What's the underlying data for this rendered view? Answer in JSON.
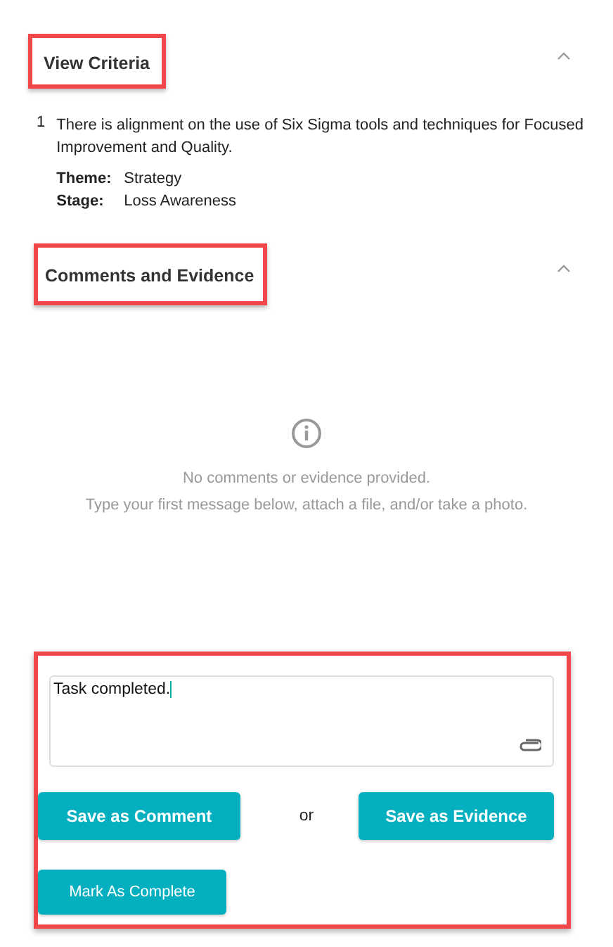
{
  "criteria_section": {
    "title": "View Criteria",
    "expanded": true,
    "items": [
      {
        "number": "1",
        "text": "There is alignment on the use of Six Sigma tools and techniques for Focused Improvement and Quality.",
        "fields": [
          {
            "label": "Theme:",
            "value": "Strategy"
          },
          {
            "label": "Stage:",
            "value": "Loss Awareness"
          }
        ]
      }
    ]
  },
  "comments_section": {
    "title": "Comments and Evidence",
    "expanded": true,
    "empty_state": {
      "title": "No comments or evidence provided.",
      "hint": "Type your first message below, attach a file, and/or take a photo."
    },
    "message": {
      "value": "Task completed."
    },
    "buttons": [
      {
        "label": "Save as Comment"
      },
      {
        "label": "Save as Evidence"
      }
    ],
    "separator": "or",
    "complete_button": {
      "label": "Mark As Complete"
    }
  }
}
